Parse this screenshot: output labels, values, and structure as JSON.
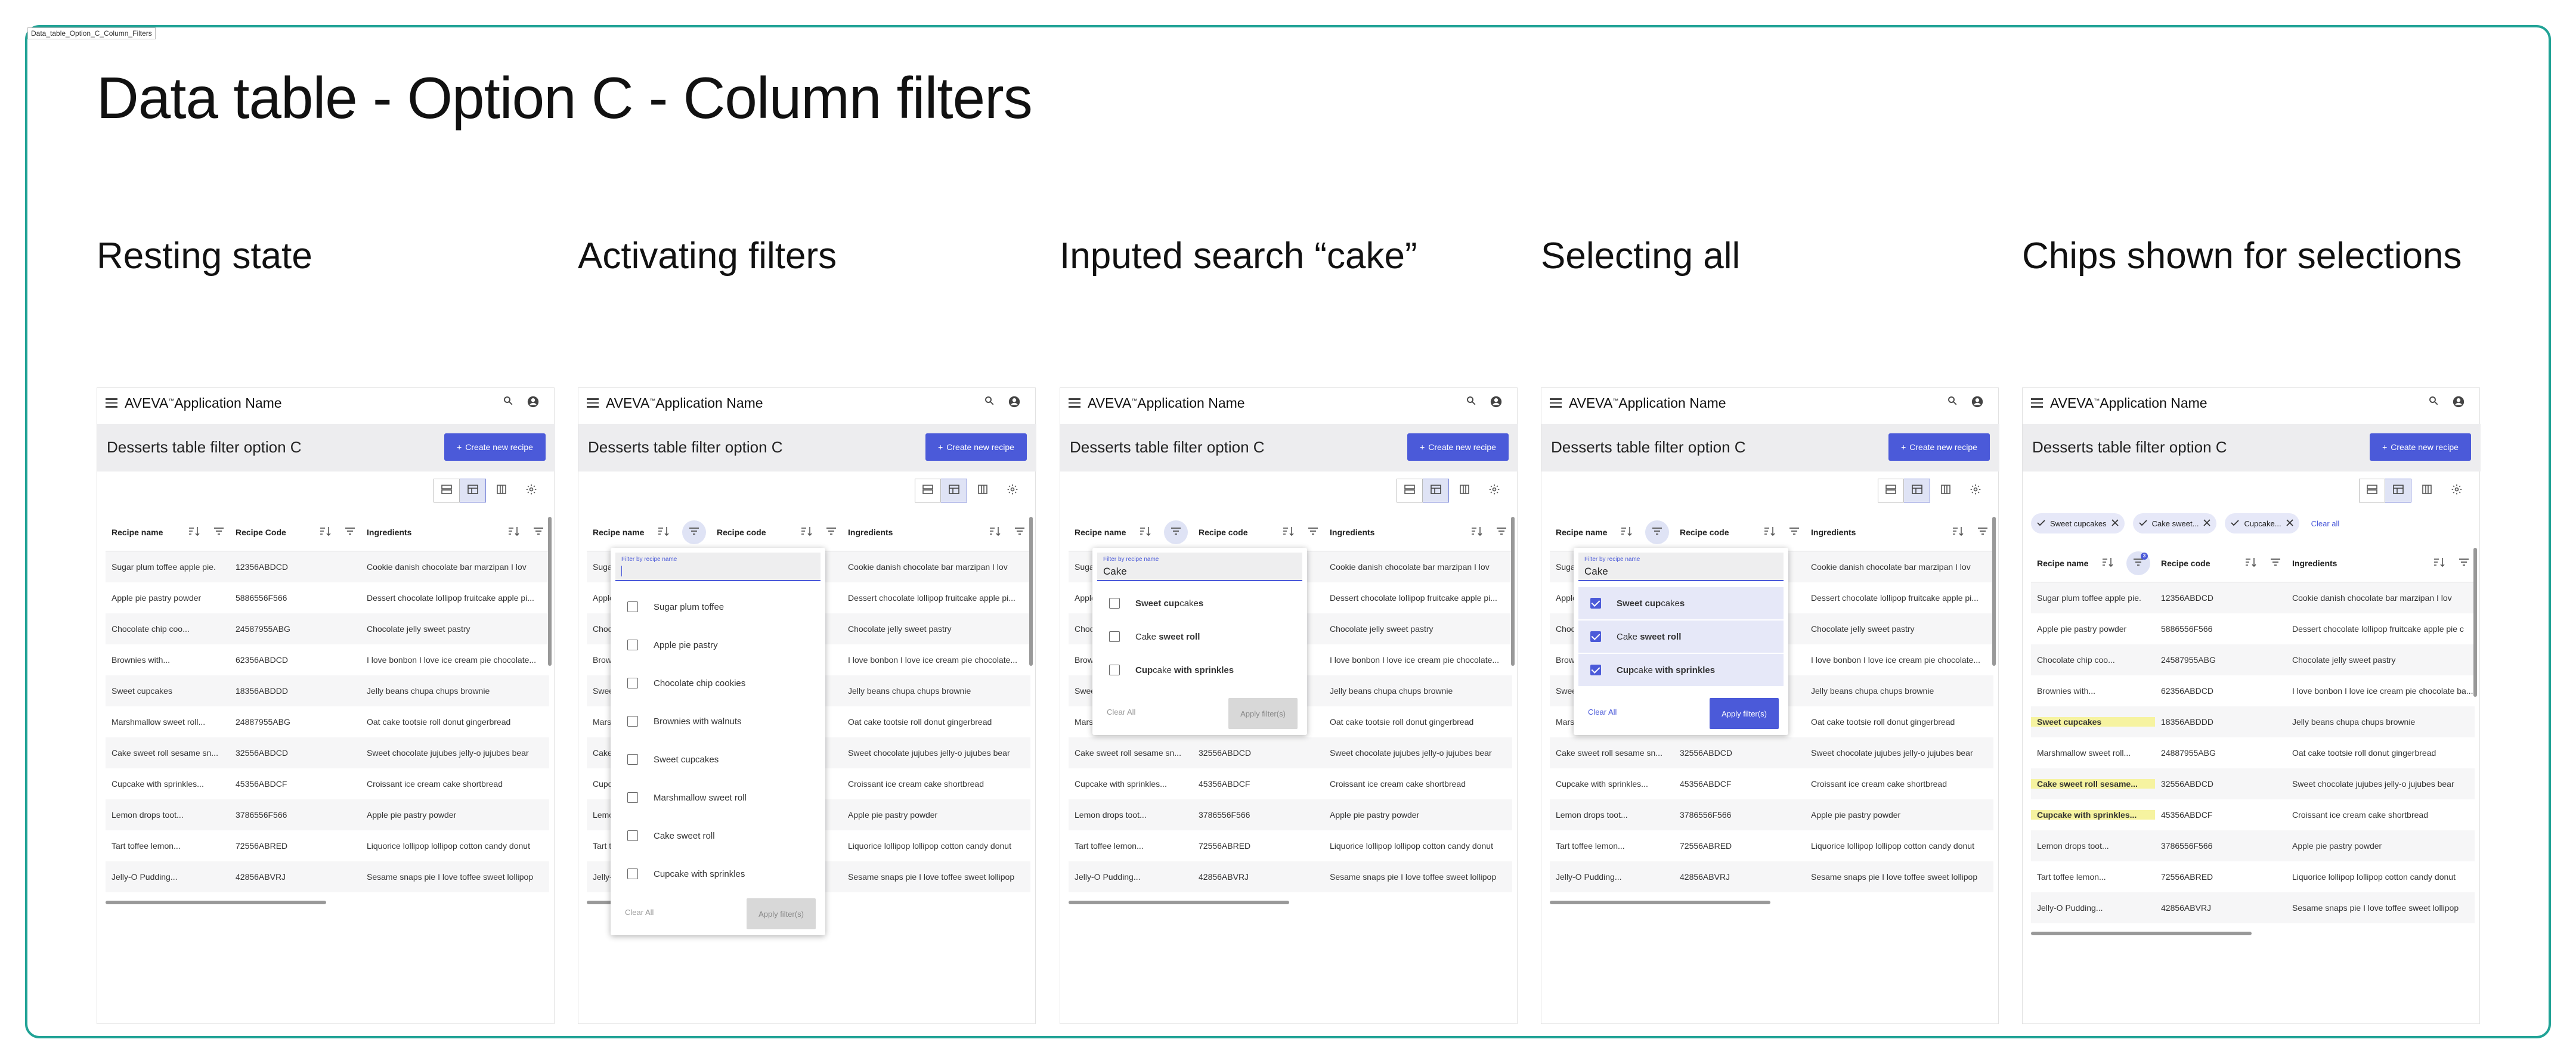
{
  "frame_label": "Data_table_Option_C_Column_Filters",
  "page_title": "Data table - Option C - Column filters",
  "app": {
    "name": "AVEVA",
    "name_suffix": "Application Name",
    "page_title": "Desserts table filter option C",
    "create_label": "Create new recipe"
  },
  "states": [
    {
      "heading": "Resting state"
    },
    {
      "heading": "Activating filters"
    },
    {
      "heading": "Inputed search “cake”"
    },
    {
      "heading": "Selecting all"
    },
    {
      "heading": "Chips shown for selections"
    }
  ],
  "columns": {
    "name": "Recipe name",
    "code_resting": "Recipe Code",
    "code": "Recipe code",
    "ingredients": "Ingredients"
  },
  "rows": [
    {
      "name": "Sugar plum toffee apple pie.",
      "name_b": "Sugar plum toffee apple pie.",
      "code": "12356ABDCD",
      "ing": "Cookie danish chocolate bar marzipan I lov"
    },
    {
      "name": "Apple pie pastry powder",
      "code": "5886556F566",
      "ing": "Dessert chocolate lollipop fruitcake apple pi..."
    },
    {
      "name": "Chocolate chip coo...",
      "code": "24587955ABG",
      "ing": "Chocolate jelly sweet pastry"
    },
    {
      "name": "Brownies with...",
      "code": "62356ABDCD",
      "ing": "I love bonbon I love ice cream pie chocolate..."
    },
    {
      "name": "Sweet cupcakes",
      "code": "18356ABDDD",
      "ing": "Jelly beans chupa chups brownie"
    },
    {
      "name": "Marshmallow sweet roll...",
      "code": "24887955ABG",
      "ing": "Oat cake tootsie roll donut gingerbread"
    },
    {
      "name": "Cake sweet roll sesame sn...",
      "code": "32556ABDCD",
      "ing": "Sweet chocolate jujubes jelly-o jujubes bear"
    },
    {
      "name": "Cupcake with sprinkles...",
      "code": "45356ABDCF",
      "ing": "Croissant ice cream cake shortbread"
    },
    {
      "name": "Lemon drops toot...",
      "code": "3786556F566",
      "ing": "Apple pie pastry powder"
    },
    {
      "name": "Tart toffee lemon...",
      "code": "72556ABRED",
      "ing": "Liquorice lollipop lollipop cotton candy donut"
    },
    {
      "name": "Jelly-O Pudding...",
      "code": "42856ABVRJ",
      "ing": "Sesame snaps pie I love toffee sweet lollipop"
    }
  ],
  "rows_chips_variant": {
    "row0_name": "Sugar plum toffee apple pie.",
    "row1_ing": "Dessert chocolate lollipop fruitcake apple pie c",
    "row3_ing": "I love bonbon I love ice cream pie chocolate ba...",
    "row6_name": "Cake sweet roll sesame...",
    "row7_name": "Cupcake with sprinkles..."
  },
  "filter": {
    "label": "Filter by recipe name",
    "search_value": "Cake",
    "options": [
      "Sugar plum toffee",
      "Apple pie pastry",
      "Chocolate chip cookies",
      "Brownies with walnuts",
      "Sweet cupcakes",
      "Marshmallow sweet roll",
      "Cake sweet roll",
      "Cupcake with sprinkles"
    ],
    "cake_options": [
      {
        "pre": "Sweet cup",
        "match": "cake",
        "post": "s"
      },
      {
        "pre": "",
        "match": "Cake",
        "post": " sweet roll"
      },
      {
        "pre": "Cup",
        "match": "cake",
        "post": " with sprinkles"
      }
    ],
    "clear_label": "Clear All",
    "clear_label_alt": "Clear All",
    "apply_label": "Apply filter(s)"
  },
  "chips": {
    "items": [
      "Sweet cupcakes",
      "Cake sweet...",
      "Cupcake..."
    ],
    "clear_all": "Clear all",
    "badge": "3"
  },
  "colors": {
    "accent": "#4b5ad9",
    "frame": "#21a396",
    "highlight": "#f6f3a0"
  }
}
